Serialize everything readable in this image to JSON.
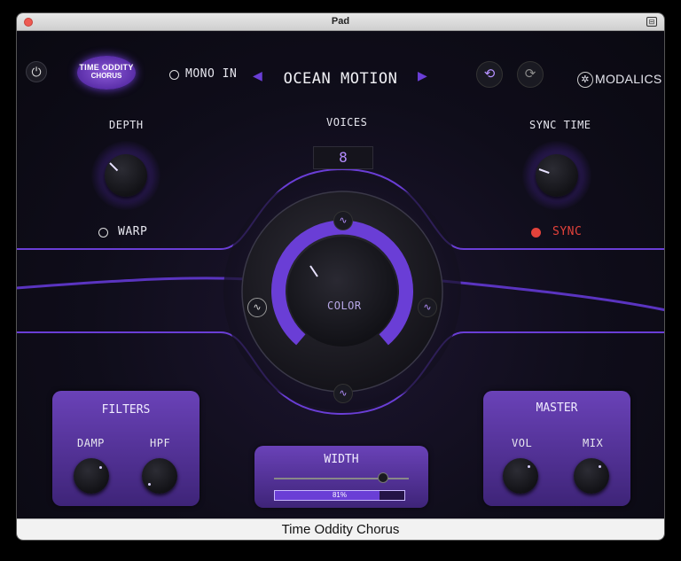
{
  "window": {
    "title": "Pad",
    "menu_icon": "window-menu-icon"
  },
  "header": {
    "logo_line1": "TIME ODDITY",
    "logo_line2": "CHORUS",
    "mono_in_label": "MONO IN",
    "preset_name": "OCEAN MOTION",
    "brand": "MODALICS"
  },
  "controls": {
    "depth_label": "DEPTH",
    "warp_label": "WARP",
    "voices_label": "VOICES",
    "voices_value": "8",
    "sync_time_label": "SYNC TIME",
    "sync_label": "SYNC",
    "color_label": "COLOR"
  },
  "filters": {
    "title": "FILTERS",
    "damp_label": "DAMP",
    "hpf_label": "HPF"
  },
  "width": {
    "title": "WIDTH",
    "value_text": "81%",
    "value": 0.81
  },
  "master": {
    "title": "MASTER",
    "vol_label": "VOL",
    "mix_label": "MIX"
  },
  "footer": {
    "text": "Time Oddity Chorus"
  },
  "colors": {
    "accent": "#6a3ed6",
    "sync_active": "#e4423b",
    "background": "#0c0b14"
  }
}
